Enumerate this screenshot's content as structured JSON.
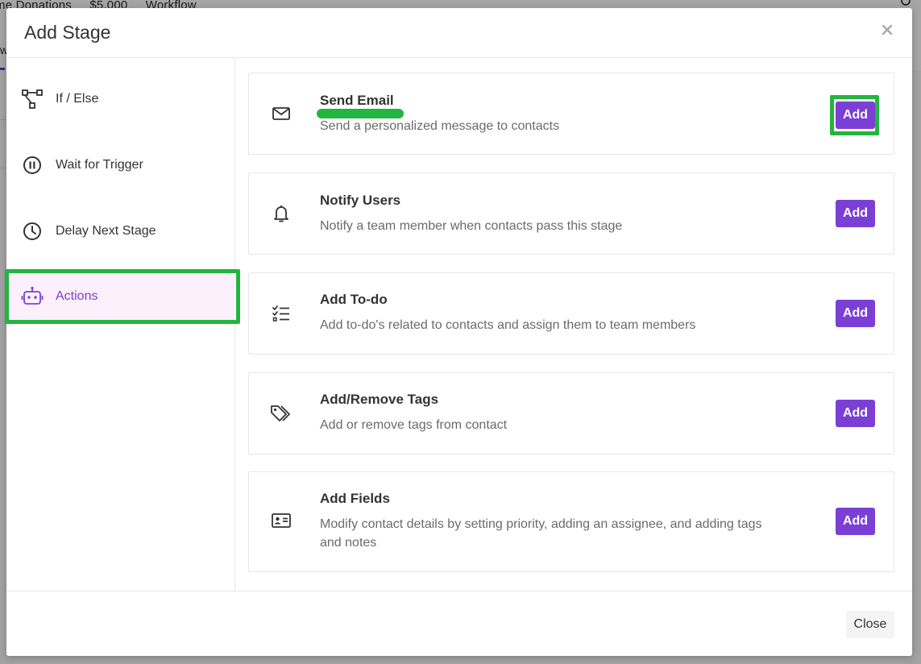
{
  "background": {
    "breadcrumb": [
      "me Donations",
      "$5,000",
      "Workflow"
    ],
    "tab_letter": "w"
  },
  "modal": {
    "title": "Add Stage",
    "close_label": "Close"
  },
  "sidebar": {
    "items": [
      {
        "label": "If / Else",
        "icon": "branch-icon"
      },
      {
        "label": "Wait for Trigger",
        "icon": "pause-circle-icon"
      },
      {
        "label": "Delay Next Stage",
        "icon": "clock-icon"
      },
      {
        "label": "Actions",
        "icon": "robot-icon",
        "active": true
      }
    ]
  },
  "actions": [
    {
      "title": "Send Email",
      "description": "Send a personalized message to contacts",
      "icon": "envelope-icon",
      "button": "Add"
    },
    {
      "title": "Notify Users",
      "description": "Notify a team member when contacts pass this stage",
      "icon": "bell-icon",
      "button": "Add"
    },
    {
      "title": "Add To-do",
      "description": "Add to-do's related to contacts and assign them to team members",
      "icon": "checklist-icon",
      "button": "Add"
    },
    {
      "title": "Add/Remove Tags",
      "description": "Add or remove tags from contact",
      "icon": "tags-icon",
      "button": "Add"
    },
    {
      "title": "Add Fields",
      "description": "Modify contact details by setting priority, adding an assignee, and adding tags and notes",
      "icon": "id-card-icon",
      "button": "Add"
    }
  ],
  "colors": {
    "accent": "#7b3fd6",
    "highlight": "#22b53f",
    "active_bg": "#fbf0fb"
  }
}
